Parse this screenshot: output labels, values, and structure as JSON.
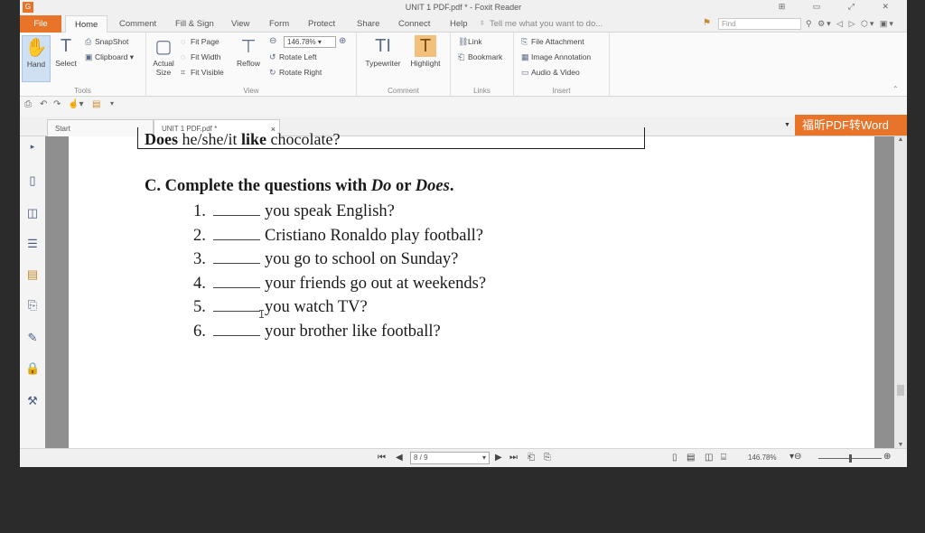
{
  "window": {
    "title": "UNIT 1 PDF.pdf * - Foxit Reader",
    "controls": "⊞  ▭  ⤢  ✕"
  },
  "menu": {
    "file": "File",
    "tabs": [
      "Home",
      "Comment",
      "Fill & Sign",
      "View",
      "Form",
      "Protect",
      "Share",
      "Connect",
      "Help"
    ],
    "tell_me": "Tell me what you want to do...",
    "find_placeholder": "Find"
  },
  "ribbon": {
    "tools": {
      "hand": "Hand",
      "select": "Select",
      "snapshot": "SnapShot",
      "clipboard": "Clipboard",
      "label": "Tools"
    },
    "view": {
      "actual_size": "Actual Size",
      "fit_page": "Fit Page",
      "fit_width": "Fit Width",
      "fit_visible": "Fit Visible",
      "reflow": "Reflow",
      "zoom_value": "146.78%",
      "rotate_left": "Rotate Left",
      "rotate_right": "Rotate Right",
      "label": "View"
    },
    "comment": {
      "typewriter": "Typewriter",
      "highlight": "Highlight",
      "label": "Comment"
    },
    "links": {
      "link": "Link",
      "bookmark": "Bookmark",
      "label": "Links"
    },
    "insert": {
      "file_attachment": "File Attachment",
      "image_annotation": "Image Annotation",
      "audio_video": "Audio & Video",
      "label": "Insert"
    }
  },
  "doc_tabs": {
    "start": "Start",
    "current": "UNIT 1 PDF.pdf *",
    "close": "×"
  },
  "promo": "福昕PDF转Word",
  "document": {
    "prev_question_bold": "Does",
    "prev_question_mid": " he/she/it ",
    "prev_question_bold2": "like",
    "prev_question_end": " chocolate?",
    "heading_pre": "C. Complete the questions with ",
    "heading_do": "Do",
    "heading_or": " or ",
    "heading_does": "Does",
    "heading_end": ".",
    "questions": [
      {
        "num": "1.",
        "text": "you speak English?"
      },
      {
        "num": "2.",
        "text": "Cristiano Ronaldo play football?"
      },
      {
        "num": "3.",
        "text": "you go to school on Sunday?"
      },
      {
        "num": "4.",
        "text": "your friends go out at weekends?"
      },
      {
        "num": "5.",
        "text": "you watch TV?"
      },
      {
        "num": "6.",
        "text": "your brother like football?"
      }
    ]
  },
  "status": {
    "page": "8 / 9",
    "zoom": "146.78%"
  }
}
